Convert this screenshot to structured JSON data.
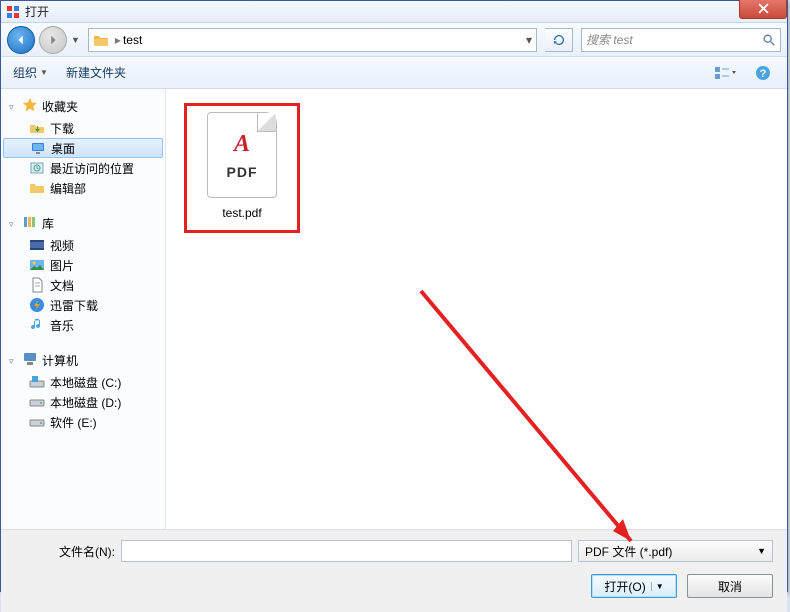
{
  "title": "打开",
  "breadcrumb": {
    "folder": "test"
  },
  "search": {
    "placeholder": "搜索 test"
  },
  "toolbar": {
    "organize": "组织",
    "new_folder": "新建文件夹"
  },
  "sidebar": {
    "favorites": {
      "label": "收藏夹",
      "items": [
        {
          "label": "下载",
          "icon": "download"
        },
        {
          "label": "桌面",
          "icon": "desktop",
          "selected": true
        },
        {
          "label": "最近访问的位置",
          "icon": "recent"
        },
        {
          "label": "编辑部",
          "icon": "folder"
        }
      ]
    },
    "libraries": {
      "label": "库",
      "items": [
        {
          "label": "视频",
          "icon": "video"
        },
        {
          "label": "图片",
          "icon": "picture"
        },
        {
          "label": "文档",
          "icon": "document"
        },
        {
          "label": "迅雷下载",
          "icon": "thunder"
        },
        {
          "label": "音乐",
          "icon": "music"
        }
      ]
    },
    "computer": {
      "label": "计算机",
      "items": [
        {
          "label": "本地磁盘 (C:)",
          "icon": "sysdrive"
        },
        {
          "label": "本地磁盘 (D:)",
          "icon": "drive"
        },
        {
          "label": "软件 (E:)",
          "icon": "drive"
        }
      ]
    }
  },
  "files": [
    {
      "name": "test.pdf",
      "type_label": "PDF"
    }
  ],
  "footer": {
    "filename_label": "文件名(N):",
    "filetype": "PDF 文件 (*.pdf)",
    "open": "打开(O)",
    "cancel": "取消"
  }
}
